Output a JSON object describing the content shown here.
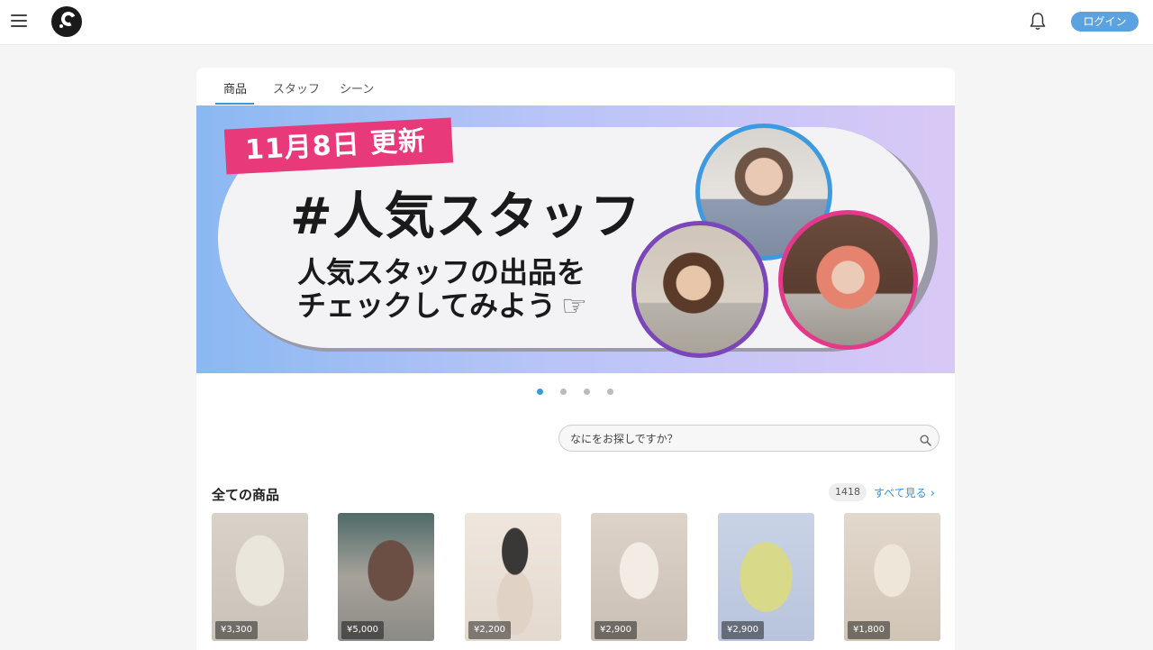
{
  "header": {
    "menu_icon": "hamburger-menu-icon",
    "logo_icon": "brand-logo",
    "bell_icon": "bell-icon",
    "login_label": "ログイン",
    "accent_color": "#5aa3e0"
  },
  "tabs": [
    {
      "label": "商品",
      "active": true
    },
    {
      "label": "スタッフ",
      "active": false
    },
    {
      "label": "シーン",
      "active": false
    }
  ],
  "banner": {
    "date": "11月8日 更新",
    "headline": "#人気スタッフ",
    "sub_line1": "人気スタッフの出品を",
    "sub_line2": "チェックしてみよう",
    "hand_icon": "☞",
    "tag_color": "#e8397a"
  },
  "carousel": {
    "total": 4,
    "active_index": 0
  },
  "search": {
    "placeholder": "なにをお探しですか？"
  },
  "section": {
    "title": "全ての商品",
    "count": "1418",
    "see_all_label": "すべて見る",
    "chevron_icon": "chevron-right-icon"
  },
  "products": [
    {
      "price": "¥3,300"
    },
    {
      "price": "¥5,000"
    },
    {
      "price": "¥2,200"
    },
    {
      "price": "¥2,900"
    },
    {
      "price": "¥2,900"
    },
    {
      "price": "¥1,800"
    }
  ]
}
